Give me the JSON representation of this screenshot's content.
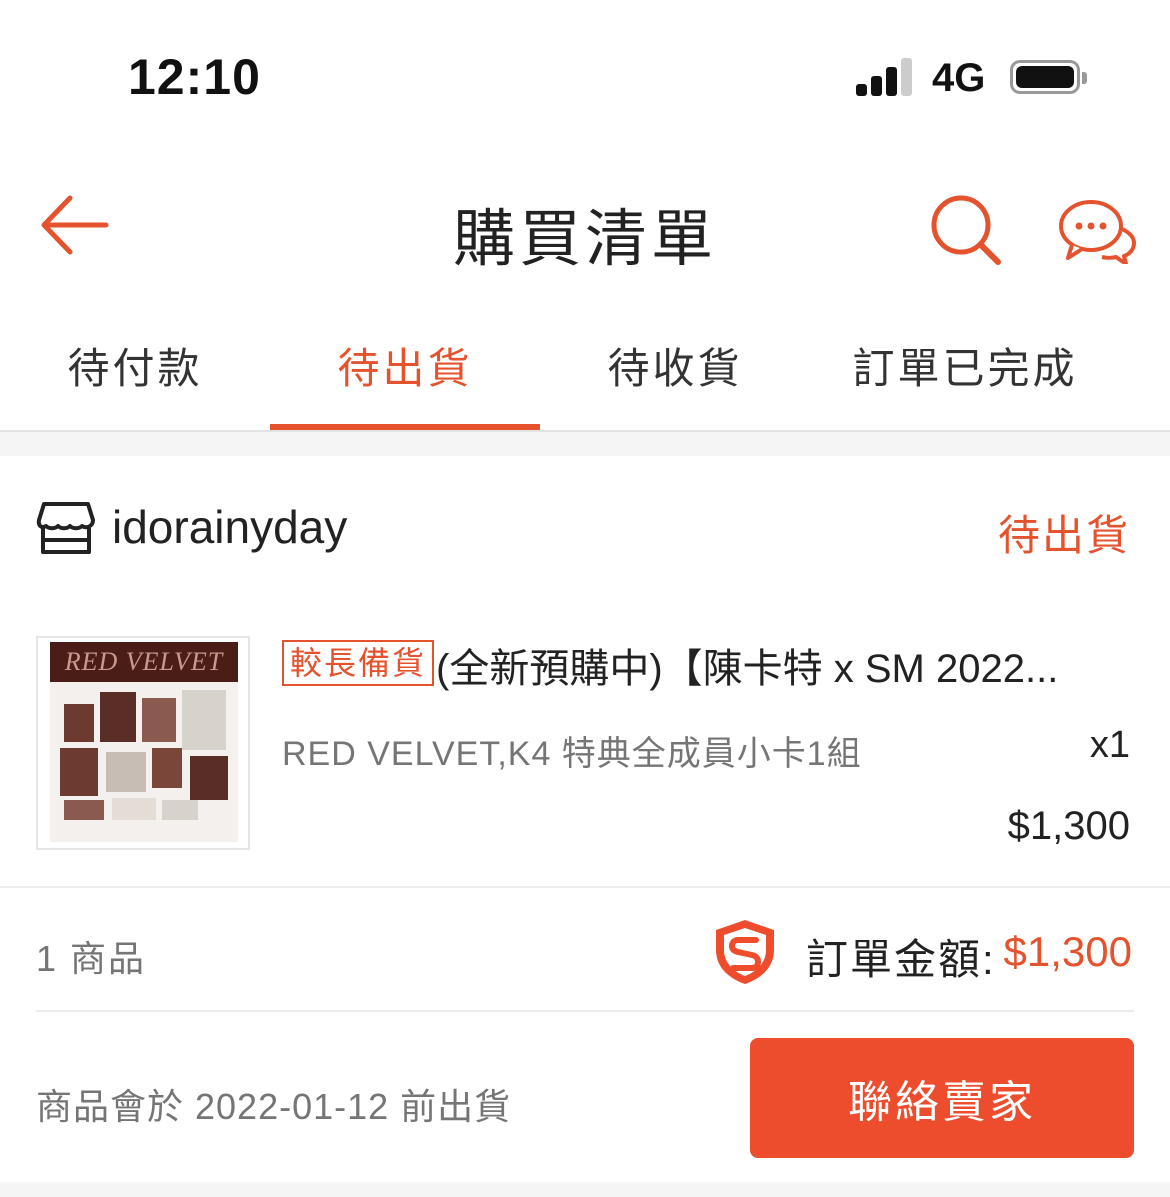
{
  "status_bar": {
    "time": "12:10",
    "network": "4G"
  },
  "header": {
    "title": "購買清單"
  },
  "tabs": [
    {
      "label": "待付款",
      "active": false
    },
    {
      "label": "待出貨",
      "active": true
    },
    {
      "label": "待收貨",
      "active": false
    },
    {
      "label": "訂單已完成",
      "active": false
    }
  ],
  "order": {
    "shop_name": "idorainyday",
    "status": "待出貨",
    "item": {
      "image_text": "RED VELVET",
      "tag": "較長備貨",
      "title": "(全新預購中)【陳卡特 x SM 2022...",
      "variant": "RED VELVET,K4 特典全成員小卡1組",
      "quantity": "x1",
      "price": "$1,300"
    },
    "item_count": "1 商品",
    "total_label": "訂單金額:",
    "total_value": "$1,300",
    "ship_note": "商品會於 2022-01-12 前出貨",
    "contact_button": "聯絡賣家"
  },
  "colors": {
    "accent": "#ee4d2d",
    "text": "#222222",
    "muted": "#757575"
  },
  "icons": [
    "back-arrow-icon",
    "search-icon",
    "chat-icon",
    "shop-icon",
    "shield-icon"
  ]
}
